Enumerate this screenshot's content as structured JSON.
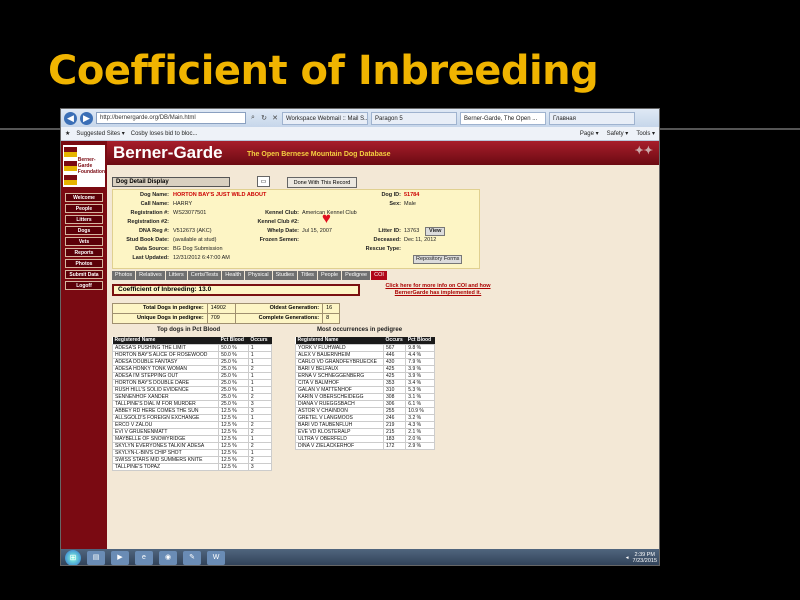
{
  "slide": {
    "title": "Coefficient of Inbreeding"
  },
  "browser": {
    "url": "http://bernergarde.org/DB/Main.html",
    "tabs": [
      "Workspace Webmail :: Mail S...",
      "Paragon 5",
      "Berner-Garde, The Open ...",
      "Главная"
    ],
    "favorites": [
      "Suggested Sites ▾",
      "Cosby loses bid to bloc..."
    ],
    "toolbar": [
      "Page ▾",
      "Safety ▾",
      "Tools ▾"
    ]
  },
  "site": {
    "brand": "Berner-Garde",
    "tagline": "The Open Bernese Mountain Dog Database",
    "logo_text": [
      "Berner-",
      "Garde",
      "Foundation"
    ],
    "nav": [
      "Welcome",
      "People",
      "Litters",
      "Dogs",
      "Vets",
      "Reports",
      "Photos",
      "Submit Data",
      "Logoff"
    ]
  },
  "detail": {
    "display_label": "Dog Detail Display",
    "done_button": "Done With This Record",
    "labels": {
      "dog_name": "Dog Name:",
      "call_name": "Call Name:",
      "registration1": "Registration #:",
      "registration2": "Registration #2:",
      "dna": "DNA Reg #:",
      "stud_book": "Stud Book Date:",
      "data_source": "Data Source:",
      "last_updated": "Last Updated:",
      "dog_id": "Dog ID:",
      "sex": "Sex:",
      "kennel_club": "Kennel Club:",
      "kennel_club2": "Kennel Club #2:",
      "whelp_date": "Whelp Date:",
      "frozen_semen": "Frozen Semen:",
      "litter_id": "Litter ID:",
      "deceased": "Deceased:",
      "rescue_type": "Rescue Type:"
    },
    "values": {
      "dog_name": "HORTON BAY'S JUST WILD ABOUT",
      "call_name": "HARRY",
      "registration1": "WS23077501",
      "dna": "V512673 (AKC)",
      "stud_book": "(available at stud)",
      "data_source": "BG Dog Submission",
      "last_updated": "12/31/2012 6:47:00 AM",
      "dog_id": "51784",
      "sex": "Male",
      "kennel_club": "American Kennel Club",
      "whelp_date": "Jul 15, 2007",
      "litter_id": "13763",
      "deceased": "Dec 11, 2012"
    },
    "view_button": "View",
    "repository_button": "Repository Forms"
  },
  "tabs": [
    "Photos",
    "Relatives",
    "Litters",
    "Certs/Tests",
    "Health",
    "Physical",
    "Studies",
    "Titles",
    "People",
    "Pedigree",
    "COI"
  ],
  "active_tab": "COI",
  "coi": {
    "label": "Coefficient of Inbreeding:",
    "value": "13.0",
    "link": "Click here for more info on COI and how BernerGarde has implemented it."
  },
  "stats": [
    {
      "label": "Total Dogs in pedigree:",
      "value": "14902",
      "label2": "Oldest Generation:",
      "value2": "16"
    },
    {
      "label": "Unique Dogs in pedigree:",
      "value": "709",
      "label2": "Complete Generations:",
      "value2": "8"
    }
  ],
  "top_dogs": {
    "title": "Top dogs in Pct Blood",
    "headers": [
      "Registered Name",
      "Pct Blood",
      "Occurs"
    ],
    "rows": [
      [
        "ADESA'S PUSHING THE LIMIT",
        "50.0 %",
        "1"
      ],
      [
        "HORTON BAY'S ALICE OF ROSEWOOD",
        "50.0 %",
        "1"
      ],
      [
        "ADESA DOUBLE FANTASY",
        "25.0 %",
        "1"
      ],
      [
        "ADESA HONKY TONK WOMAN",
        "25.0 %",
        "2"
      ],
      [
        "ADESA I'M STEPPING OUT",
        "25.0 %",
        "1"
      ],
      [
        "HORTON BAY'S DOUBLE DARE",
        "25.0 %",
        "1"
      ],
      [
        "RUSH HILL'S SOLID EVIDENCE",
        "25.0 %",
        "1"
      ],
      [
        "SENNENHOF XANDER",
        "25.0 %",
        "2"
      ],
      [
        "TALLPINE'S DIAL M FOR MURDER",
        "25.0 %",
        "3"
      ],
      [
        "ABBEY RD HERE COMES THE SUN",
        "12.5 %",
        "3"
      ],
      [
        "ALLSGOLD'S FOREIGN EXCHANGE",
        "12.5 %",
        "1"
      ],
      [
        "ERCO V ZALOU",
        "12.5 %",
        "2"
      ],
      [
        "EVI V GRUENENMATT",
        "12.5 %",
        "2"
      ],
      [
        "MAYBELLE OF SNOWYRIDGE",
        "12.5 %",
        "1"
      ],
      [
        "SKYLYN EVERYONES TALKIN' ADESA",
        "12.5 %",
        "2"
      ],
      [
        "SKYLYN-L-BIN'S CHIP SHOT",
        "12.5 %",
        "1"
      ],
      [
        "SWISS STARS MID SUMMERS KNITE",
        "12.5 %",
        "2"
      ],
      [
        "TALLPINE'S TOPAZ",
        "12.5 %",
        "3"
      ]
    ]
  },
  "most_occur": {
    "title": "Most occurrences in pedigree",
    "headers": [
      "Registered Name",
      "Occurs",
      "Pct Blood"
    ],
    "rows": [
      [
        "YORK V FLUHWALD",
        "567",
        "9.8 %"
      ],
      [
        "ALEX V BAUERNHEIM",
        "446",
        "4.4 %"
      ],
      [
        "CARLO VD GRANDFEYBRUECKE",
        "430",
        "7.9 %"
      ],
      [
        "BARI V BELFAUX",
        "425",
        "3.9 %"
      ],
      [
        "ERNA V SCHNEGGENBERG",
        "425",
        "3.9 %"
      ],
      [
        "CITA V BALMHOF",
        "353",
        "3.4 %"
      ],
      [
        "GALAN V MATTENHOF",
        "310",
        "5.3 %"
      ],
      [
        "KARIN V OBERSCHEIDEGG",
        "308",
        "3.1 %"
      ],
      [
        "DIANA V RUEGGSBACH",
        "306",
        "6.1 %"
      ],
      [
        "ASTOR V CHAINDON",
        "255",
        "10.9 %"
      ],
      [
        "GRETEL V LANGMOOS",
        "246",
        "3.2 %"
      ],
      [
        "BARI VD TAUBENFLUH",
        "219",
        "4.3 %"
      ],
      [
        "EVE VD KLOSTERALP",
        "215",
        "2.1 %"
      ],
      [
        "ULTRA V OBERFELD",
        "183",
        "2.0 %"
      ],
      [
        "DINA V ZIELACKERHOF",
        "172",
        "2.9 %"
      ]
    ]
  },
  "taskbar": {
    "time": "2:39 PM",
    "date": "7/23/2015"
  }
}
